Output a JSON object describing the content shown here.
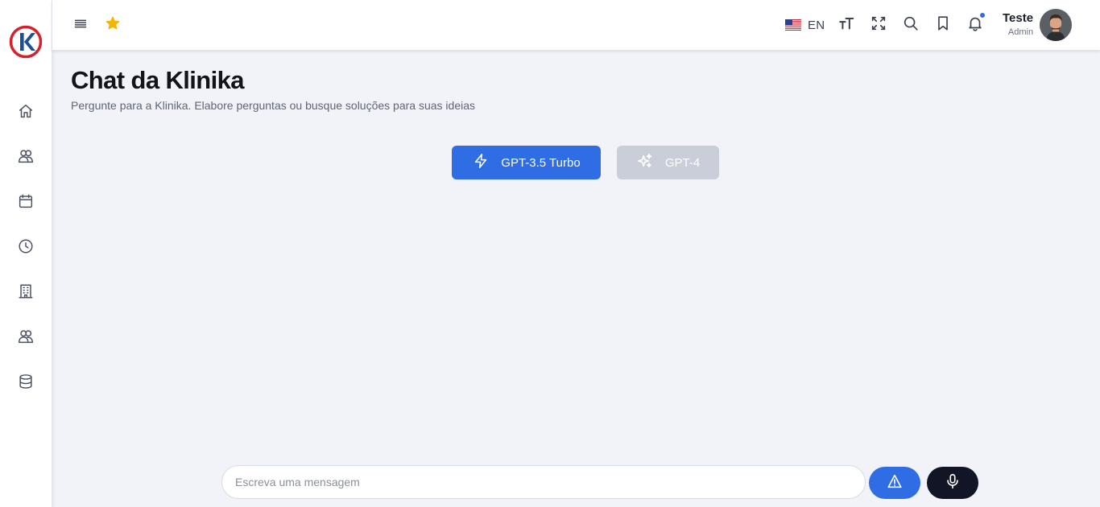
{
  "app": {
    "brand_icon": "klinika-logo",
    "brand_colors": {
      "ring": "#d8202c",
      "letter": "#1e4f95"
    }
  },
  "sidebar": {
    "items": [
      {
        "icon": "home-icon"
      },
      {
        "icon": "users-icon"
      },
      {
        "icon": "calendar-icon"
      },
      {
        "icon": "clock-icon"
      },
      {
        "icon": "building-icon"
      },
      {
        "icon": "team-icon"
      },
      {
        "icon": "database-icon"
      }
    ]
  },
  "header": {
    "menu_icon": "hamburger-icon",
    "favorite_icon": "star-icon",
    "language": {
      "code": "EN",
      "flag": "us-flag-icon"
    },
    "actions": [
      "text-size-icon",
      "fullscreen-icon",
      "search-icon",
      "bookmark-icon",
      "bell-icon"
    ],
    "notification_dot": true,
    "user": {
      "name": "Teste",
      "role": "Admin"
    }
  },
  "main": {
    "title": "Chat da Klinika",
    "subtitle": "Pergunte para a Klinika. Elabore perguntas ou busque soluções para suas ideias",
    "models": [
      {
        "label": "GPT-3.5 Turbo",
        "icon": "bolt-icon",
        "active": true
      },
      {
        "label": "GPT-4",
        "icon": "sparkles-icon",
        "active": false
      }
    ]
  },
  "composer": {
    "placeholder": "Escreva uma mensagem",
    "value": "",
    "send_icon": "send-icon",
    "mic_icon": "microphone-icon"
  },
  "colors": {
    "accent": "#2f6de5",
    "dark": "#121526",
    "background": "#f1f3f8",
    "disabled": "#c9ced8"
  }
}
